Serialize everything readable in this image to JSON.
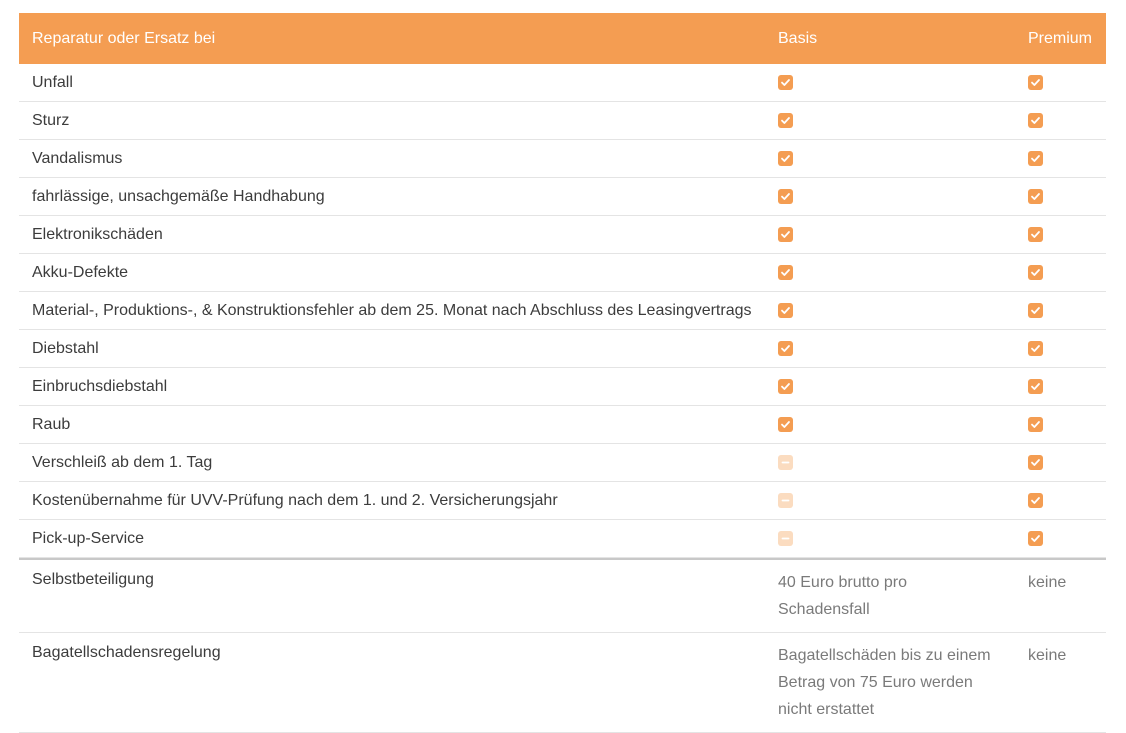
{
  "header": {
    "label": "Reparatur oder Ersatz bei",
    "basis": "Basis",
    "premium": "Premium"
  },
  "colors": {
    "accent": "#f49d52",
    "accent_muted": "#fbdcc0"
  },
  "rows": [
    {
      "label": "Unfall",
      "basis": "checked",
      "premium": "checked"
    },
    {
      "label": "Sturz",
      "basis": "checked",
      "premium": "checked"
    },
    {
      "label": "Vandalismus",
      "basis": "checked",
      "premium": "checked"
    },
    {
      "label": "fahrlässige, unsachgemäße Handhabung",
      "basis": "checked",
      "premium": "checked"
    },
    {
      "label": "Elektronikschäden",
      "basis": "checked",
      "premium": "checked"
    },
    {
      "label": "Akku-Defekte",
      "basis": "checked",
      "premium": "checked"
    },
    {
      "label": "Material-, Produktions-, & Konstruktionsfehler ab dem 25. Monat nach Abschluss des Leasingvertrags",
      "basis": "checked",
      "premium": "checked"
    },
    {
      "label": "Diebstahl",
      "basis": "checked",
      "premium": "checked"
    },
    {
      "label": "Einbruchsdiebstahl",
      "basis": "checked",
      "premium": "checked"
    },
    {
      "label": "Raub",
      "basis": "checked",
      "premium": "checked"
    },
    {
      "label": "Verschleiß ab dem 1. Tag",
      "basis": "unchecked",
      "premium": "checked"
    },
    {
      "label": "Kostenübernahme für UVV-Prüfung nach dem 1. und 2. Versicherungsjahr",
      "basis": "unchecked",
      "premium": "checked"
    },
    {
      "label": "Pick-up-Service",
      "basis": "unchecked",
      "premium": "checked"
    }
  ],
  "text_rows": [
    {
      "label": "Selbstbeteiligung",
      "basis": "40 Euro brutto pro Schadensfall",
      "premium": "keine"
    },
    {
      "label": "Bagatellschadensregelung",
      "basis": "Bagatellschäden bis zu einem Betrag von 75 Euro werden nicht erstattet",
      "premium": "keine"
    }
  ]
}
